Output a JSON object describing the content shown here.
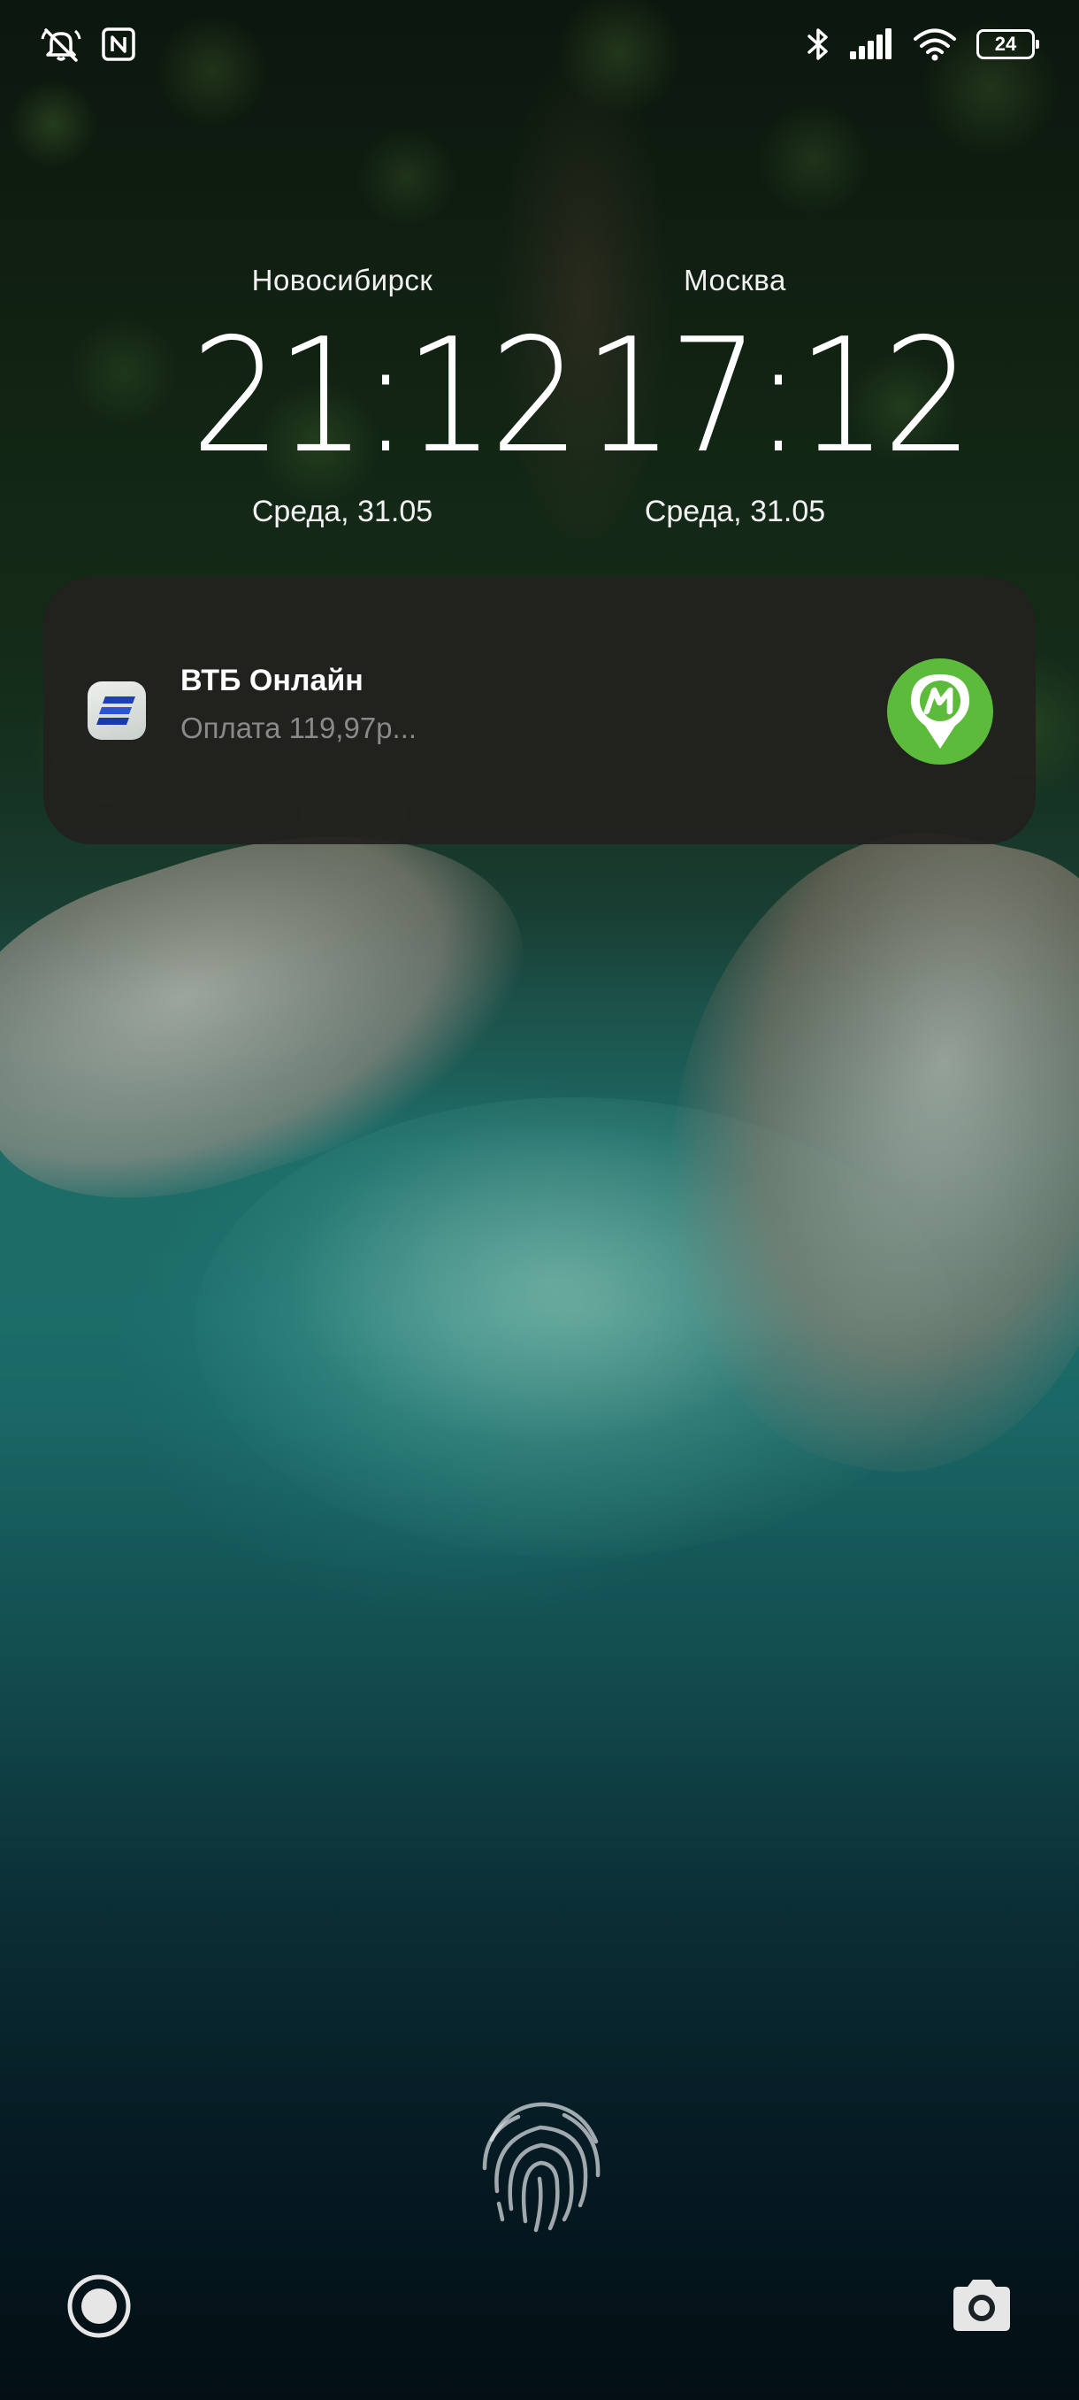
{
  "status_bar": {
    "left_icons": [
      "notifications-muted-icon",
      "nfc-icon"
    ],
    "right_icons": [
      "bluetooth-icon",
      "cellular-signal-icon",
      "wifi-icon",
      "battery-icon"
    ],
    "battery_level": "24"
  },
  "clocks": [
    {
      "city": "Новосибирск",
      "time": "21:12",
      "date": "Среда, 31.05"
    },
    {
      "city": "Москва",
      "time": "17:12",
      "date": "Среда, 31.05"
    }
  ],
  "notification": {
    "app_name": "ВТБ Онлайн",
    "message": "Оплата 119,97р...",
    "app_icon": "vtb-logo-icon",
    "badge_icon": "map-pin-m-icon",
    "badge_color": "#5cbb3a"
  },
  "bottom": {
    "fingerprint_icon": "fingerprint-icon",
    "left_shortcut_icon": "voice-assistant-icon",
    "right_shortcut_icon": "camera-icon"
  }
}
